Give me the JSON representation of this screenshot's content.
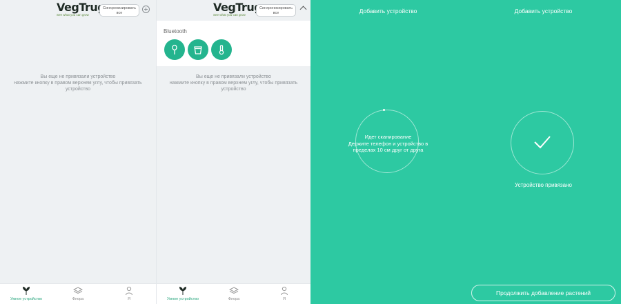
{
  "brand": {
    "name": "VegTrug",
    "tagline": "See what you can grow"
  },
  "screen1": {
    "header": {
      "sync_label": "Синхронизировать все"
    },
    "empty_message": [
      "Вы еще не привязали устройство",
      "нажмите кнопку в правом верхнем углу, чтобы привязать",
      "устройство"
    ],
    "tabs": [
      "Умное устройство",
      "Флора",
      "Я"
    ]
  },
  "screen2": {
    "header": {
      "sync_label": "Синхронизировать все"
    },
    "bluetooth": {
      "title": "Bluetooth",
      "devices": [
        "sensor-probe-icon",
        "flowerpot-icon",
        "thermometer-icon"
      ]
    },
    "empty_message": [
      "Вы еще не привязали устройство",
      "нажмите кнопку в правом верхнем углу, чтобы привязать",
      "устройство"
    ],
    "tabs": [
      "Умное устройство",
      "Флора",
      "Я"
    ]
  },
  "screen3": {
    "title": "Добавить устройство",
    "scanning": [
      "Идет сканирование",
      "Держите телефон и устройство в",
      "пределах 10 см друг от друга"
    ]
  },
  "screen4": {
    "title": "Добавить устройство",
    "status": "Устройство привязано",
    "continue_label": "Продолжить добавление растений"
  },
  "colors": {
    "accent_green": "#2dc9a2",
    "device_green": "#24b48e",
    "active_tab": "#2aa67e",
    "background": "#eef1f3"
  }
}
